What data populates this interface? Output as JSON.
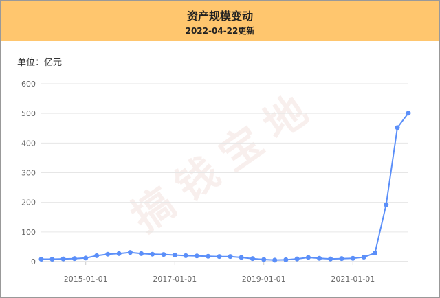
{
  "header": {
    "title": "资产规模变动",
    "subtitle": "2022-04-22更新"
  },
  "unit_label": "单位：亿元",
  "watermark": "搞钱宝地",
  "colors": {
    "header_bg": "#ffc66e",
    "series": "#5b8ff9",
    "grid": "#e6e6e6"
  },
  "chart_data": {
    "type": "line",
    "title": "资产规模变动",
    "ylabel": "单位：亿元",
    "ylim": [
      0,
      600
    ],
    "yticks": [
      0,
      100,
      200,
      300,
      400,
      500,
      600
    ],
    "xticks": [
      "2015-01-01",
      "2017-01-01",
      "2019-01-01",
      "2021-01-01"
    ],
    "grid": true,
    "x": [
      "2014-01-01",
      "2014-04-01",
      "2014-07-01",
      "2014-10-01",
      "2015-01-01",
      "2015-04-01",
      "2015-07-01",
      "2015-10-01",
      "2016-01-01",
      "2016-04-01",
      "2016-07-01",
      "2016-10-01",
      "2017-01-01",
      "2017-04-01",
      "2017-07-01",
      "2017-10-01",
      "2018-01-01",
      "2018-04-01",
      "2018-07-01",
      "2018-10-01",
      "2019-01-01",
      "2019-04-01",
      "2019-07-01",
      "2019-10-01",
      "2020-01-01",
      "2020-04-01",
      "2020-07-01",
      "2020-10-01",
      "2021-01-01",
      "2021-04-01",
      "2021-07-01",
      "2021-10-01",
      "2022-01-01",
      "2022-04-01"
    ],
    "series": [
      {
        "values": [
          8,
          8,
          9,
          10,
          12,
          20,
          25,
          27,
          31,
          27,
          25,
          24,
          22,
          20,
          19,
          18,
          17,
          17,
          14,
          10,
          7,
          5,
          6,
          9,
          14,
          11,
          9,
          10,
          11,
          15,
          29,
          192,
          452,
          501
        ]
      }
    ]
  }
}
